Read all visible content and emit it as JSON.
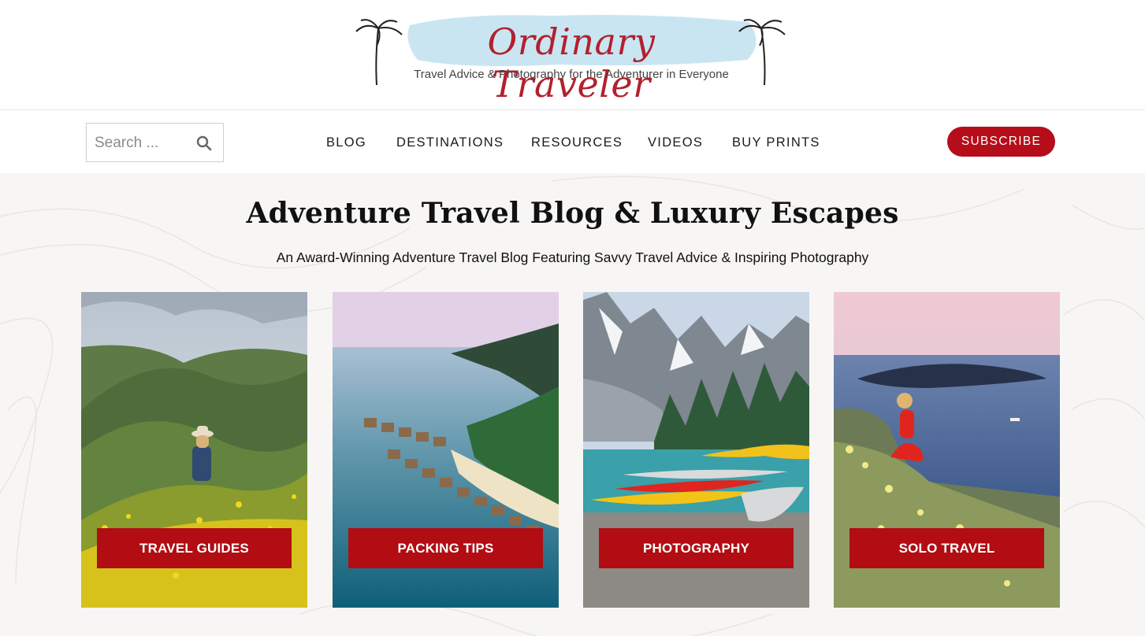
{
  "logo": {
    "title": "Ordinary Traveler",
    "tagline": "Travel Advice & Photography  for the Adventurer in Everyone"
  },
  "search": {
    "placeholder": "Search ...",
    "icon": "search-icon"
  },
  "nav": {
    "items": [
      {
        "label": "BLOG"
      },
      {
        "label": "DESTINATIONS"
      },
      {
        "label": "RESOURCES"
      },
      {
        "label": "VIDEOS"
      },
      {
        "label": "BUY PRINTS"
      }
    ],
    "subscribe_label": "SUBSCRIBE"
  },
  "hero": {
    "title": "Adventure Travel Blog & Luxury Escapes",
    "subtitle": "An Award-Winning Adventure Travel Blog Featuring Savvy Travel Advice & Inspiring Photography"
  },
  "categories": [
    {
      "label": "TRAVEL GUIDES"
    },
    {
      "label": "PACKING TIPS"
    },
    {
      "label": "PHOTOGRAPHY"
    },
    {
      "label": "SOLO TRAVEL"
    }
  ],
  "colors": {
    "brand_red": "#b3202e",
    "button_red": "#b10d12",
    "page_bg": "#f7f6f4"
  }
}
